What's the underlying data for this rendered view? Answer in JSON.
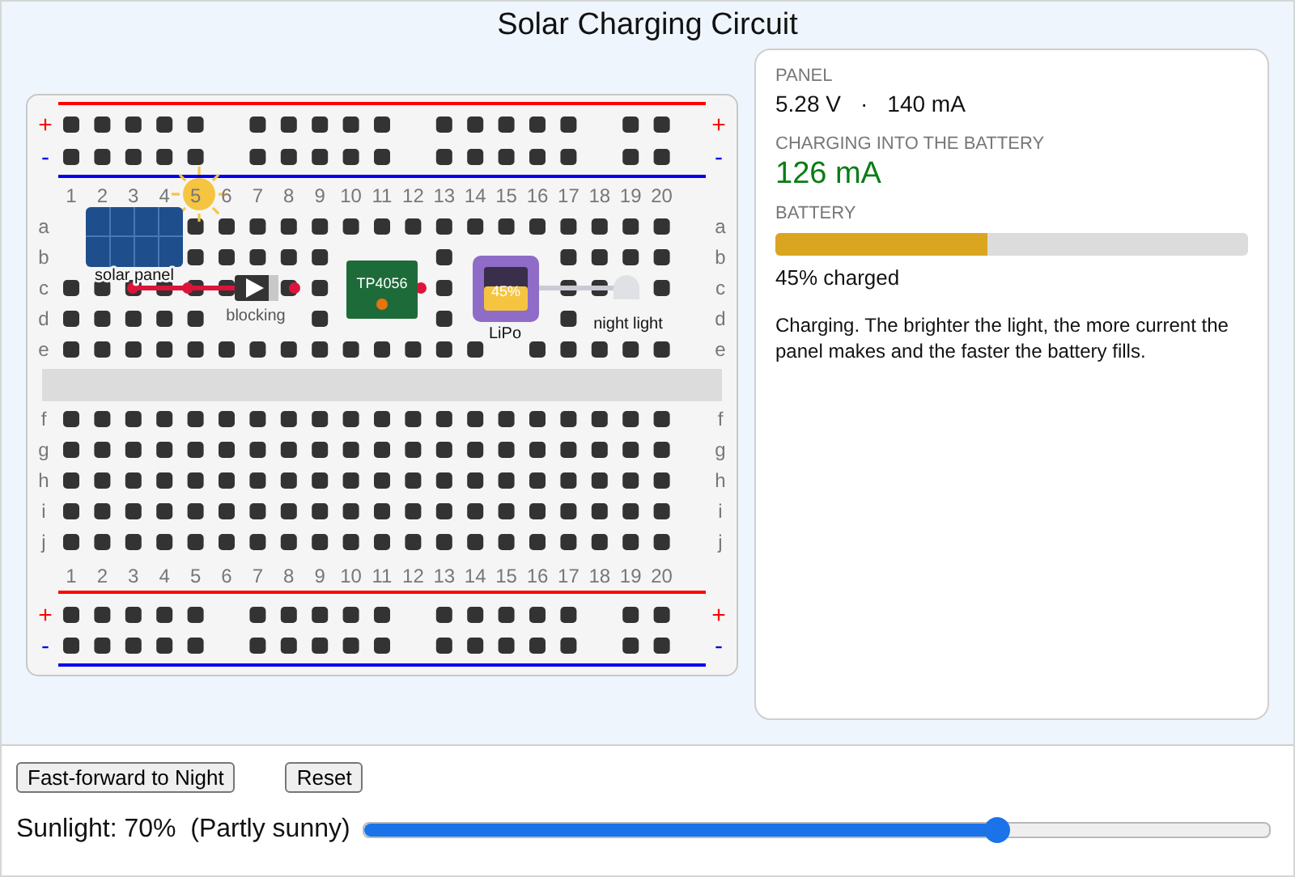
{
  "title": "Solar Charging Circuit",
  "breadboard": {
    "top_rails": [
      {
        "kind": "positive",
        "left": "+",
        "right": "+"
      },
      {
        "kind": "negative",
        "left": "-",
        "right": "-"
      }
    ],
    "top_numbers": [
      "1",
      "2",
      "3",
      "4",
      "5",
      "6",
      "7",
      "8",
      "9",
      "10",
      "11",
      "12",
      "13",
      "14",
      "15",
      "16",
      "17",
      "18",
      "19",
      "20"
    ],
    "top_rows": [
      {
        "left": "a",
        "right": "a"
      },
      {
        "left": "b",
        "right": "b"
      },
      {
        "left": "c",
        "right": "c"
      },
      {
        "left": "d",
        "right": "d"
      },
      {
        "left": "e",
        "right": "e"
      }
    ],
    "bottom_rows": [
      {
        "left": "f",
        "right": "f"
      },
      {
        "left": "g",
        "right": "g"
      },
      {
        "left": "h",
        "right": "h"
      },
      {
        "left": "i",
        "right": "i"
      },
      {
        "left": "j",
        "right": "j"
      }
    ],
    "bottom_numbers": [
      "1",
      "2",
      "3",
      "4",
      "5",
      "6",
      "7",
      "8",
      "9",
      "10",
      "11",
      "12",
      "13",
      "14",
      "15",
      "16",
      "17",
      "18",
      "19",
      "20"
    ],
    "bottom_rails": [
      {
        "kind": "positive",
        "left": "+",
        "right": "+"
      },
      {
        "kind": "negative",
        "left": "-",
        "right": "-"
      }
    ],
    "components": [
      {
        "kind": "solar_panel",
        "label": "solar panel"
      },
      {
        "kind": "diode",
        "label": "blocking"
      },
      {
        "kind": "charger",
        "label": "TP4056"
      },
      {
        "kind": "battery",
        "label": "LiPo",
        "display": "45%"
      },
      {
        "kind": "lamp",
        "label": "night light"
      }
    ]
  },
  "readout": {
    "panel": {
      "heading": "PANEL",
      "voltage": "5.28 V",
      "separator": "·",
      "current": "140 mA"
    },
    "charging": {
      "heading": "CHARGING INTO THE BATTERY",
      "value": "126 mA"
    },
    "battery": {
      "heading": "BATTERY",
      "level": 0.45,
      "caption": "45% charged"
    },
    "message": "Charging. The brighter the light, the more current the panel makes and the faster the battery fills."
  },
  "buttons": [
    "Fast-forward to Night",
    "Reset"
  ],
  "sunlight": {
    "label": "Sunlight: 70%  (Partly sunny)",
    "level": 0.7
  }
}
